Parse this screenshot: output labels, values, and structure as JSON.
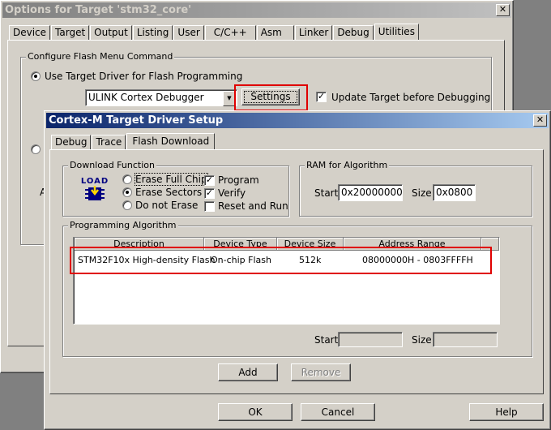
{
  "outer": {
    "title": "Options for Target 'stm32_core'",
    "tabs": [
      "Device",
      "Target",
      "Output",
      "Listing",
      "User",
      "C/C++",
      "Asm",
      "Linker",
      "Debug",
      "Utilities"
    ],
    "selected_tab": "Utilities",
    "group_title": "Configure Flash Menu Command",
    "radio_use_target": "Use Target Driver for Flash Programming",
    "driver_value": "ULINK Cortex Debugger",
    "settings_button": "Settings",
    "update_target_label": "Update Target before Debugging",
    "partial_label_a": "A"
  },
  "inner": {
    "title": "Cortex-M Target Driver Setup",
    "tabs": [
      "Debug",
      "Trace",
      "Flash Download"
    ],
    "selected_tab": "Flash Download",
    "download_function": {
      "title": "Download Function",
      "icon_text": "LOAD",
      "erase_full": "Erase Full Chip",
      "erase_sectors": "Erase Sectors",
      "do_not_erase": "Do not Erase",
      "program": "Program",
      "verify": "Verify",
      "reset_run": "Reset and Run",
      "selected": "Erase Sectors",
      "program_checked": true,
      "verify_checked": true,
      "reset_run_checked": false
    },
    "ram": {
      "title": "RAM for Algorithm",
      "start_label": "Start:",
      "start_value": "0x20000000",
      "size_label": "Size:",
      "size_value": "0x0800"
    },
    "algorithm": {
      "title": "Programming Algorithm",
      "columns": [
        "Description",
        "Device Type",
        "Device Size",
        "Address Range"
      ],
      "rows": [
        [
          "STM32F10x High-density Flash",
          "On-chip Flash",
          "512k",
          "08000000H - 0803FFFFH"
        ]
      ],
      "start_label": "Start:",
      "size_label": "Size:"
    },
    "add_button": "Add",
    "remove_button": "Remove",
    "ok_button": "OK",
    "cancel_button": "Cancel",
    "help_button": "Help"
  },
  "colors": {
    "highlight_red": "#e00000",
    "active_title": "#0a246a"
  }
}
